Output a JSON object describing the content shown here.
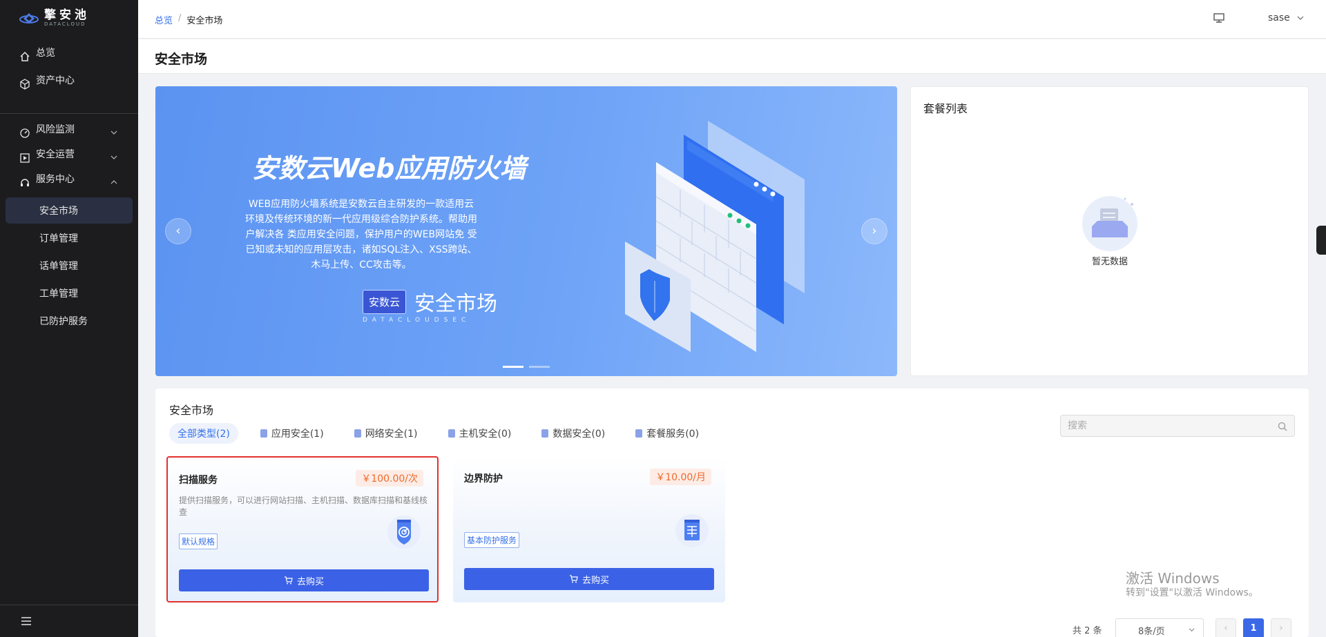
{
  "brand": {
    "name": "擎安池",
    "sub": "DATACLOUD"
  },
  "sidebar": {
    "top_items": [
      {
        "label": "总览",
        "icon": "home-icon"
      },
      {
        "label": "资产中心",
        "icon": "cube-icon"
      }
    ],
    "groups": [
      {
        "label": "风险监测",
        "icon": "gauge-icon",
        "expanded": false
      },
      {
        "label": "安全运营",
        "icon": "play-square-icon",
        "expanded": false
      },
      {
        "label": "服务中心",
        "icon": "headset-icon",
        "expanded": true
      }
    ],
    "sub_items": [
      {
        "label": "安全市场",
        "active": true
      },
      {
        "label": "订单管理"
      },
      {
        "label": "话单管理"
      },
      {
        "label": "工单管理"
      },
      {
        "label": "已防护服务"
      }
    ]
  },
  "header": {
    "breadcrumb": [
      {
        "label": "总览"
      },
      {
        "label": "安全市场"
      }
    ],
    "user": "sase"
  },
  "page": {
    "title": "安全市场"
  },
  "banner": {
    "title": "安数云Web应用防火墙",
    "desc": "WEB应用防火墙系统是安数云自主研发的一款适用云环境及传统环境的新一代应用级综合防护系统。帮助用户解决各 类应用安全问题，保护用户的WEB网站免 受已知或未知的应用层攻击，诸如SQL注入、XSS跨站、木马上传、CC攻击等。",
    "brand_box": "安数云",
    "brand_text": "安全市场",
    "brand_sub": "DATACLOUDSEC",
    "prev": "‹",
    "next": "›",
    "slides": 2,
    "current_slide": 1
  },
  "packages": {
    "title": "套餐列表",
    "empty_text": "暂无数据"
  },
  "market": {
    "title": "安全市场",
    "tabs": [
      {
        "label": "全部类型(2)",
        "active": true
      },
      {
        "label": "应用安全(1)"
      },
      {
        "label": "网络安全(1)"
      },
      {
        "label": "主机安全(0)"
      },
      {
        "label": "数据安全(0)"
      },
      {
        "label": "套餐服务(0)"
      }
    ],
    "search_placeholder": "搜索",
    "cards": [
      {
        "title": "扫描服务",
        "price": "￥100.00/次",
        "desc": "提供扫描服务，可以进行网站扫描、主机扫描、数据库扫描和基线核查",
        "tag": "默认规格",
        "buy": "去购买",
        "icon": "radar-shield-icon"
      },
      {
        "title": "边界防护",
        "price": "￥10.00/月",
        "desc": "",
        "tag": "基本防护服务",
        "buy": "去购买",
        "icon": "firewall-icon"
      }
    ]
  },
  "pagination": {
    "total": "共 2 条",
    "page_size": "8条/页",
    "current": "1",
    "prev": "‹",
    "next": "›"
  },
  "watermark": {
    "line1": "激活 Windows",
    "line2": "转到\"设置\"以激活 Windows。"
  },
  "colors": {
    "accent": "#3b62e6",
    "sidebar_bg": "#1c1c1e",
    "price": "#ee6a2a",
    "selected_border": "#e3302f"
  }
}
